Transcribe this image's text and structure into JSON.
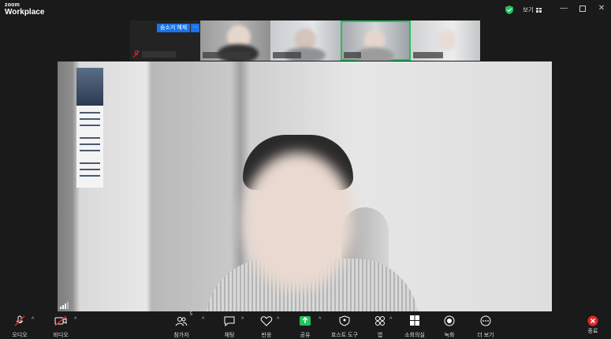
{
  "app": {
    "logo_line1": "zoom",
    "logo_line2": "Workplace",
    "view_label": "보기",
    "accent_green": "#22c15e",
    "accent_blue": "#1a73e8",
    "end_red": "#e02828"
  },
  "strip": {
    "unhide_label": "숨소거 해제",
    "more_label": "···"
  },
  "toolbar": {
    "audio": "오디오",
    "video": "비디오",
    "participants": "참가자",
    "participants_count": "5",
    "chat": "채팅",
    "reactions": "반응",
    "share": "공유",
    "host_tools": "호스트 도구",
    "apps": "앱",
    "breakout": "소회의실",
    "record": "녹화",
    "more": "더 보기",
    "end": "종료"
  },
  "icons": [
    "zoom-logo",
    "shield-check-icon",
    "grid-view-icon",
    "minimize-icon",
    "maximize-icon",
    "close-icon",
    "mic-muted-icon",
    "video-off-icon",
    "participants-icon",
    "chat-icon",
    "heart-icon",
    "share-up-icon",
    "shield-icon",
    "apps-icon",
    "breakout-grid-icon",
    "record-icon",
    "more-icon",
    "end-x-icon",
    "signal-icon"
  ]
}
